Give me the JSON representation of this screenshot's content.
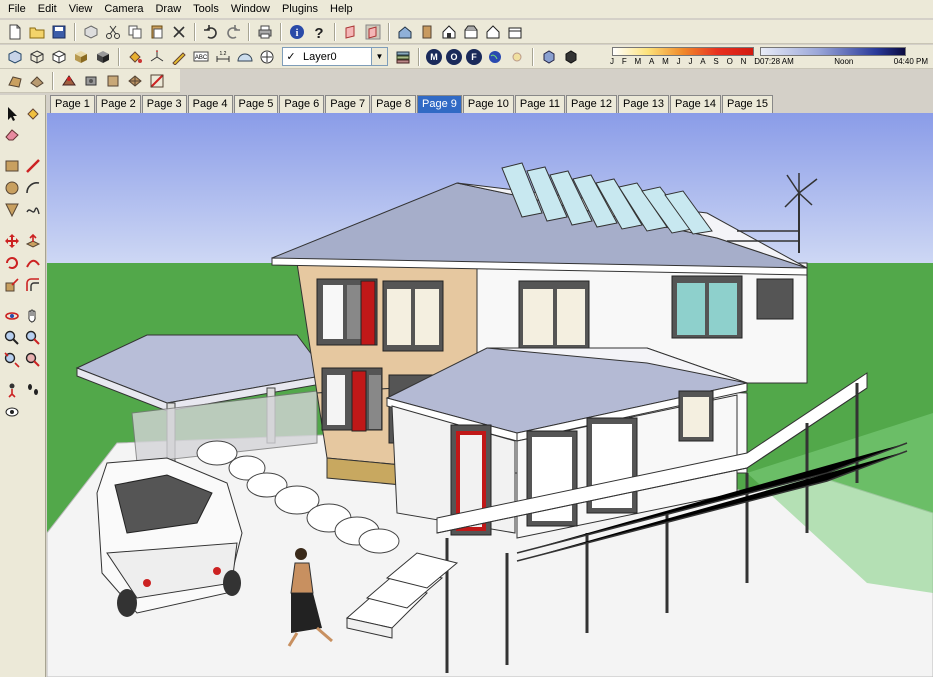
{
  "menu": {
    "items": [
      "File",
      "Edit",
      "View",
      "Camera",
      "Draw",
      "Tools",
      "Window",
      "Plugins",
      "Help"
    ]
  },
  "layers": {
    "current": "Layer0",
    "visible_check": "✓"
  },
  "shadows": {
    "months": [
      "J",
      "F",
      "M",
      "A",
      "M",
      "J",
      "J",
      "A",
      "S",
      "O",
      "N",
      "D"
    ],
    "time_start": "07:28 AM",
    "time_noon": "Noon",
    "time_end": "04:40 PM",
    "month_gradient_colors": [
      "#ffffff",
      "#fde27a",
      "#f08a2a",
      "#d21a10"
    ],
    "time_gradient_colors": [
      "#e8ecf8",
      "#2a3a9a",
      "#0a0a40"
    ]
  },
  "styles_toolbar": {
    "buttons": [
      "M",
      "O",
      "F"
    ]
  },
  "scene_tabs": {
    "items": [
      "Page 1",
      "Page 2",
      "Page 3",
      "Page 4",
      "Page 5",
      "Page 6",
      "Page 7",
      "Page 8",
      "Page 9",
      "Page 10",
      "Page 11",
      "Page 12",
      "Page 13",
      "Page 14",
      "Page 15"
    ],
    "active_index": 8
  },
  "colors": {
    "sky_top": "#8a9ce8",
    "sky_bottom": "#e4ebf8",
    "grass": "#52a84a",
    "active_tab": "#316ac5",
    "toolbar_bg": "#ece9d8"
  }
}
